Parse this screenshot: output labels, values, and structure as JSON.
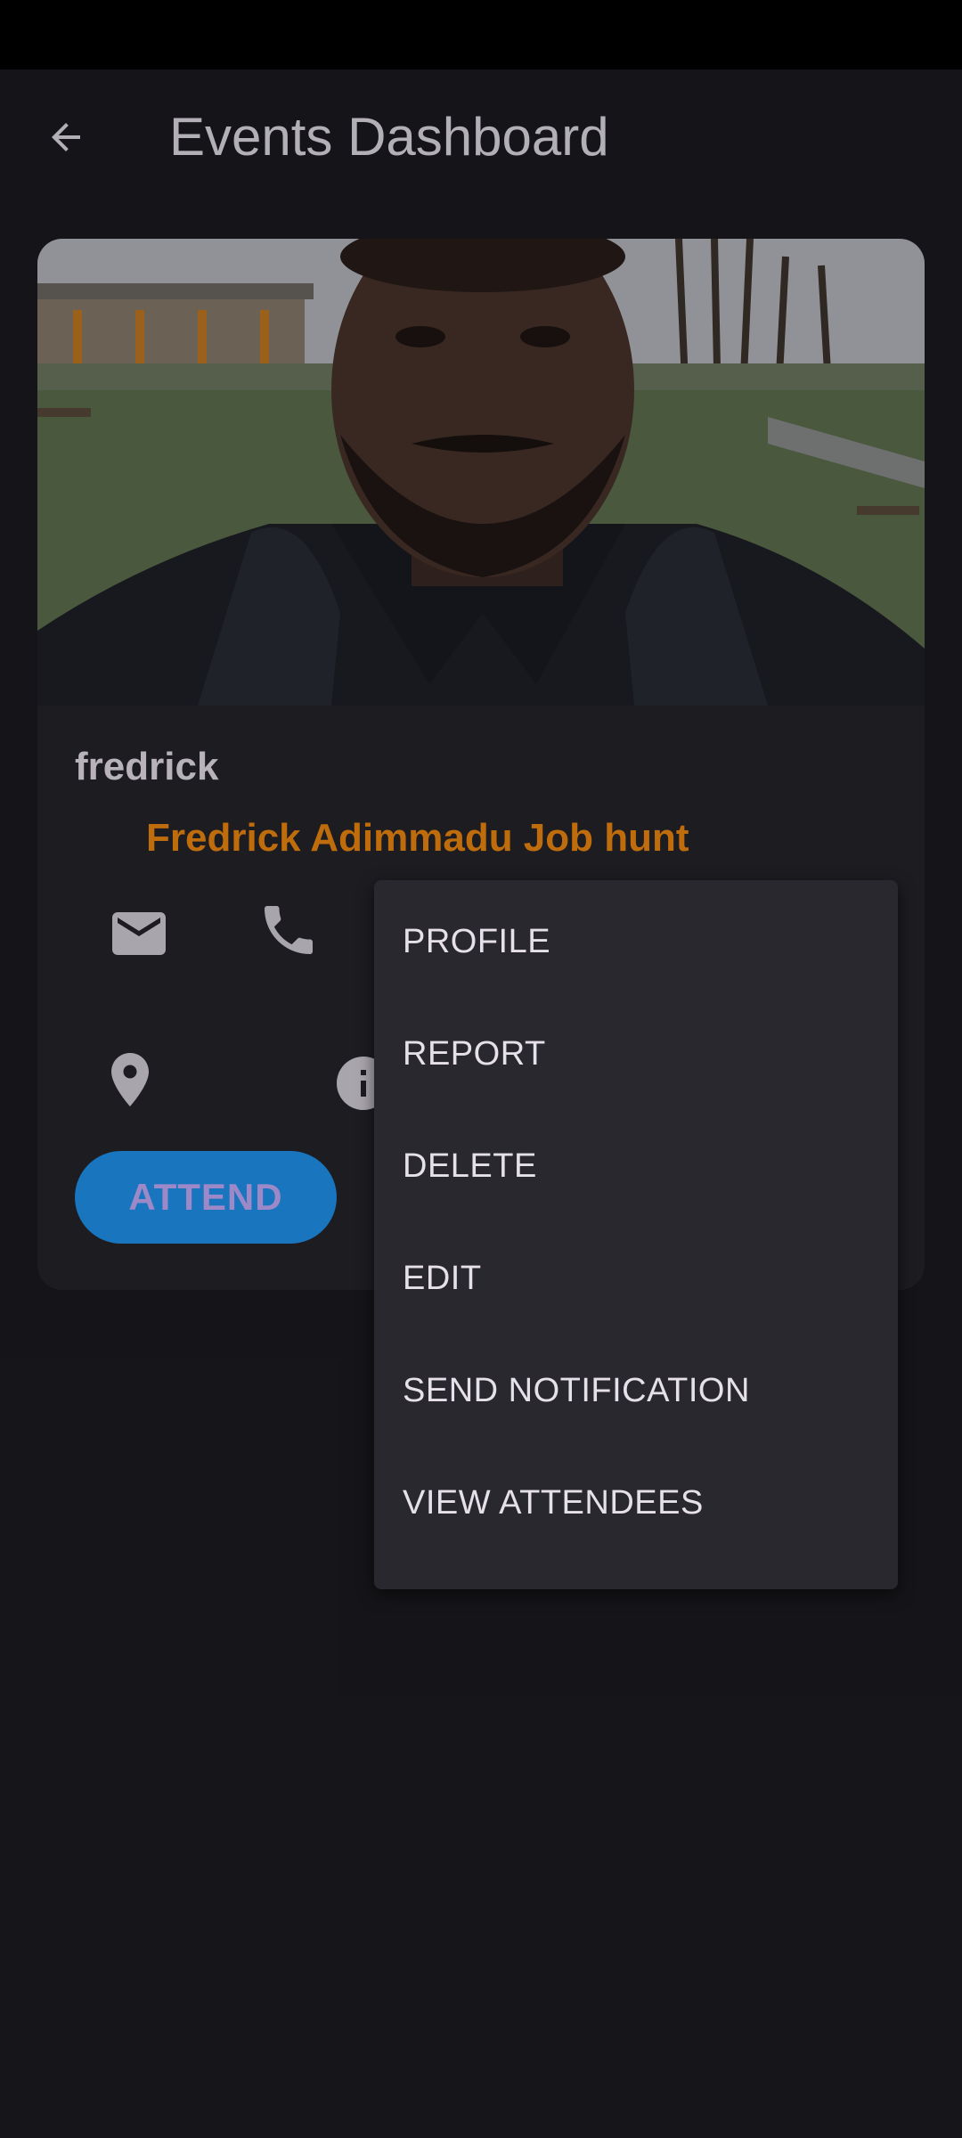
{
  "app_bar": {
    "title": "Events Dashboard",
    "back_icon": "arrow-back-icon"
  },
  "event_card": {
    "photo": "event-photo",
    "username": "fredrick",
    "event_title": "Fredrick Adimmadu Job hunt",
    "icons": [
      "email-icon",
      "phone-icon",
      "location-icon",
      "info-icon"
    ],
    "attend_label": "ATTEND"
  },
  "colors": {
    "accent_orange": "#f58b10",
    "attend_button": "#2196f3",
    "attend_text": "#c9b0ff",
    "background": "#1c1b21",
    "card": "#25242b",
    "menu": "#29282f"
  },
  "overflow_menu": {
    "items": [
      {
        "label": "PROFILE"
      },
      {
        "label": "REPORT"
      },
      {
        "label": "DELETE"
      },
      {
        "label": "EDIT"
      },
      {
        "label": "SEND NOTIFICATION"
      },
      {
        "label": "VIEW ATTENDEES"
      }
    ]
  }
}
